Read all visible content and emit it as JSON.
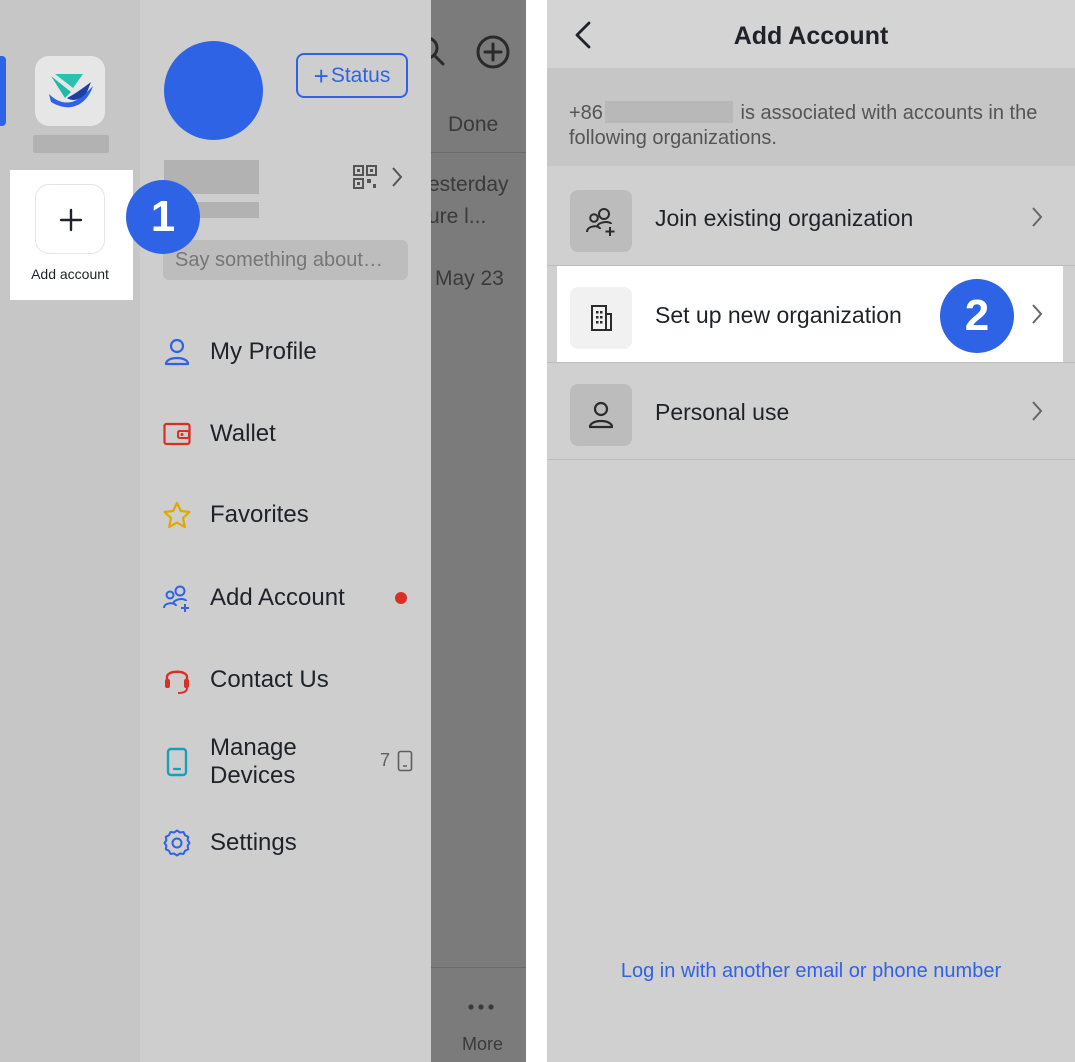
{
  "colors": {
    "accent": "#2f63e6",
    "badge_dot": "#d93026",
    "text_primary": "#1f2329"
  },
  "left": {
    "rail": {
      "add_account_label": "Add account"
    },
    "step_badge": "1",
    "drawer": {
      "status_button": {
        "icon": "plus-icon",
        "label": "Status"
      },
      "signature_placeholder": "Say something about…",
      "menu": [
        {
          "icon": "user-icon",
          "label": "My Profile"
        },
        {
          "icon": "wallet-icon",
          "label": "Wallet"
        },
        {
          "icon": "star-icon",
          "label": "Favorites"
        },
        {
          "icon": "add-people-icon",
          "label": "Add Account",
          "has_dot": true
        },
        {
          "icon": "headset-icon",
          "label": "Contact Us"
        },
        {
          "icon": "phone-device-icon",
          "label": "Manage\nDevices",
          "label_line1": "Manage",
          "label_line2": "Devices",
          "count": "7"
        },
        {
          "icon": "gear-icon",
          "label": "Settings"
        }
      ]
    },
    "overlay": {
      "done": "Done",
      "line1": "esterday",
      "line2": "ure l...",
      "line3": "May 23",
      "more": "More"
    }
  },
  "right": {
    "title": "Add Account",
    "step_badge": "2",
    "notice": {
      "prefix": "+86",
      "suffix": "is associated with accounts in the following organizations."
    },
    "options": [
      {
        "icon": "add-people-icon",
        "label": "Join existing organization"
      },
      {
        "icon": "building-icon",
        "label": "Set up new organization"
      },
      {
        "icon": "person-icon",
        "label": "Personal use"
      }
    ],
    "login_link": "Log in with another email or phone number"
  }
}
